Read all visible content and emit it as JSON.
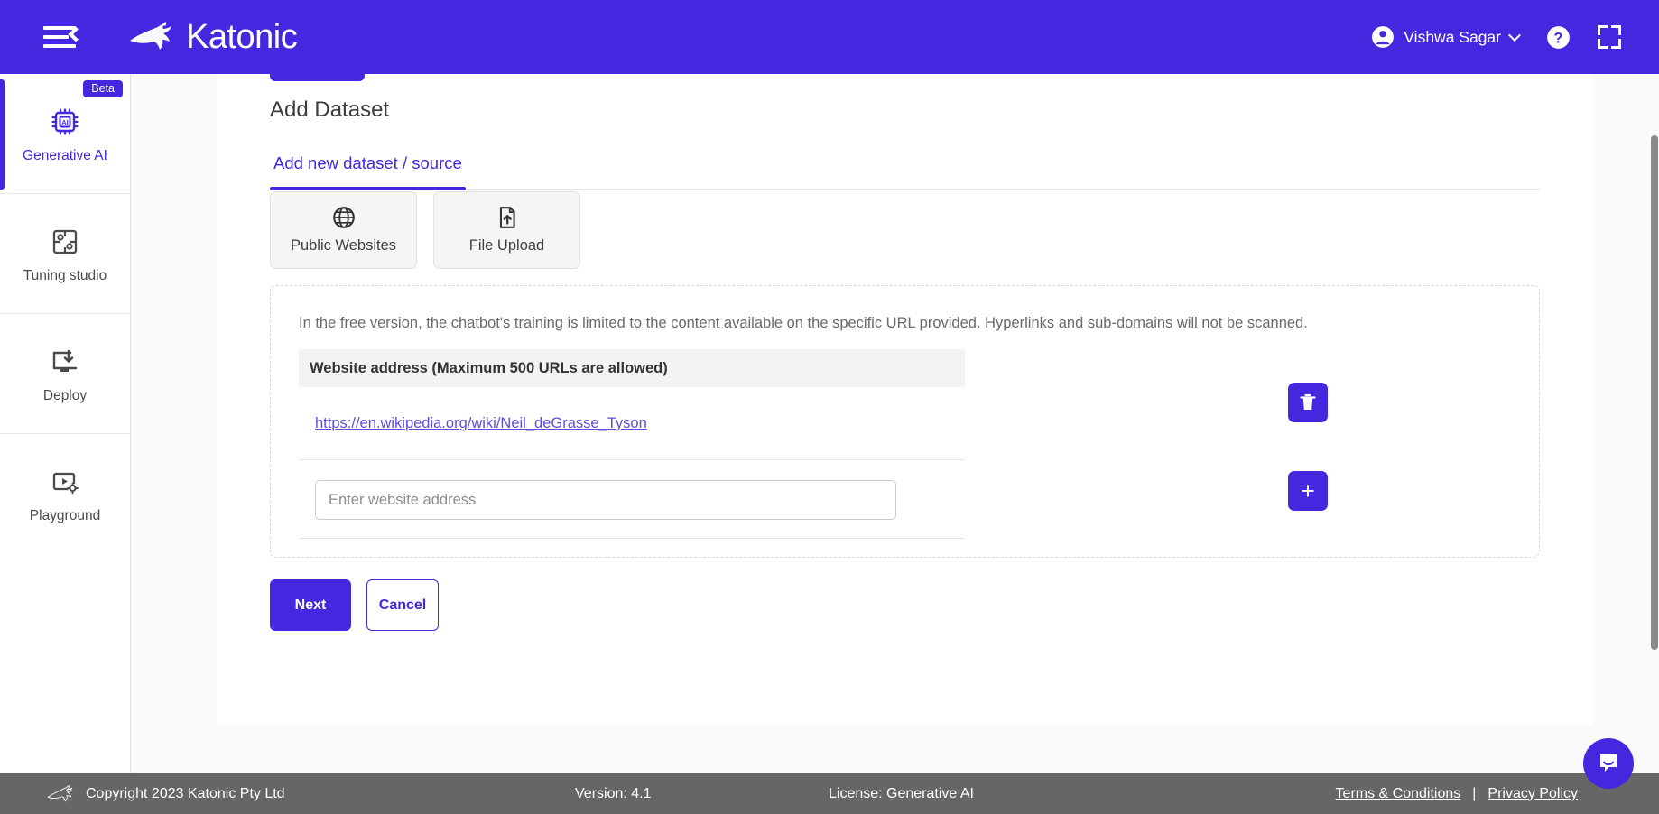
{
  "header": {
    "menu_icon": "hamburger-collapse-icon",
    "brand": "Katonic",
    "user_name": "Vishwa Sagar",
    "user_icon": "account-circle-icon",
    "help_icon": "help-circle-icon",
    "fullscreen_icon": "fullscreen-expand-icon",
    "background_color": "#4527e0"
  },
  "sidebar": {
    "items": [
      {
        "label": "Generative AI",
        "icon": "ai-chip-icon",
        "badge": "Beta",
        "active": true
      },
      {
        "label": "Tuning studio",
        "icon": "puzzle-icon",
        "badge": "",
        "active": false
      },
      {
        "label": "Deploy",
        "icon": "monitor-download-icon",
        "badge": "",
        "active": false
      },
      {
        "label": "Playground",
        "icon": "video-settings-icon",
        "badge": "",
        "active": false
      }
    ]
  },
  "main": {
    "page_title": "Add Dataset",
    "tabs": [
      {
        "label": "Add new dataset / source",
        "active": true
      }
    ],
    "source_types": [
      {
        "label": "Public Websites",
        "icon": "globe-icon",
        "selected": true
      },
      {
        "label": "File Upload",
        "icon": "file-upload-icon",
        "selected": false
      }
    ],
    "panel": {
      "note": "In the free version, the chatbot's training is limited to the content available on the specific URL provided. Hyperlinks and sub-domains will not be scanned.",
      "url_section_header": "Website address (Maximum 500 URLs are allowed)",
      "urls": [
        {
          "value": "https://en.wikipedia.org/wiki/Neil_deGrasse_Tyson",
          "delete_icon": "trash-icon"
        }
      ],
      "new_url_placeholder": "Enter website address",
      "new_url_value": "",
      "add_icon": "plus-icon"
    },
    "actions": {
      "next_label": "Next",
      "cancel_label": "Cancel"
    }
  },
  "footer": {
    "copyright": "Copyright 2023 Katonic Pty Ltd",
    "version": "Version: 4.1",
    "license": "License: Generative AI",
    "terms_label": "Terms & Conditions",
    "separator": "|",
    "privacy_label": "Privacy Policy",
    "background_color": "#666666"
  },
  "chat_widget": {
    "icon": "chat-bubble-icon",
    "color": "#4527e0"
  }
}
